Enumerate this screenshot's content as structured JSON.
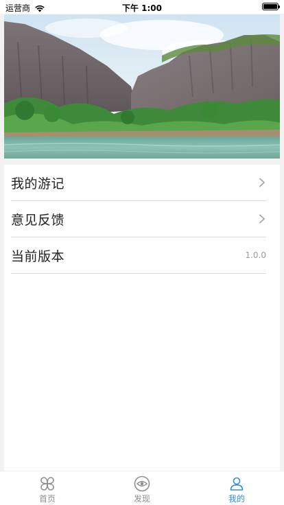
{
  "status_bar": {
    "carrier": "运营商",
    "time": "下午 1:00"
  },
  "hero": {
    "image": "mountain-river-landscape"
  },
  "menu": {
    "items": [
      {
        "label": "我的游记",
        "icon": "chevron-right-icon"
      },
      {
        "label": "意见反馈",
        "icon": "chevron-right-icon"
      },
      {
        "label": "当前版本",
        "value": "1.0.0"
      }
    ]
  },
  "tab_bar": {
    "tabs": [
      {
        "label": "首页",
        "icon": "home-clover-icon"
      },
      {
        "label": "发现",
        "icon": "eye-icon"
      },
      {
        "label": "我的",
        "icon": "user-icon",
        "active": true
      }
    ]
  },
  "colors": {
    "accent": "#2f8fd6",
    "inactive": "#8e8e8e",
    "background": "#f2f2f2"
  }
}
